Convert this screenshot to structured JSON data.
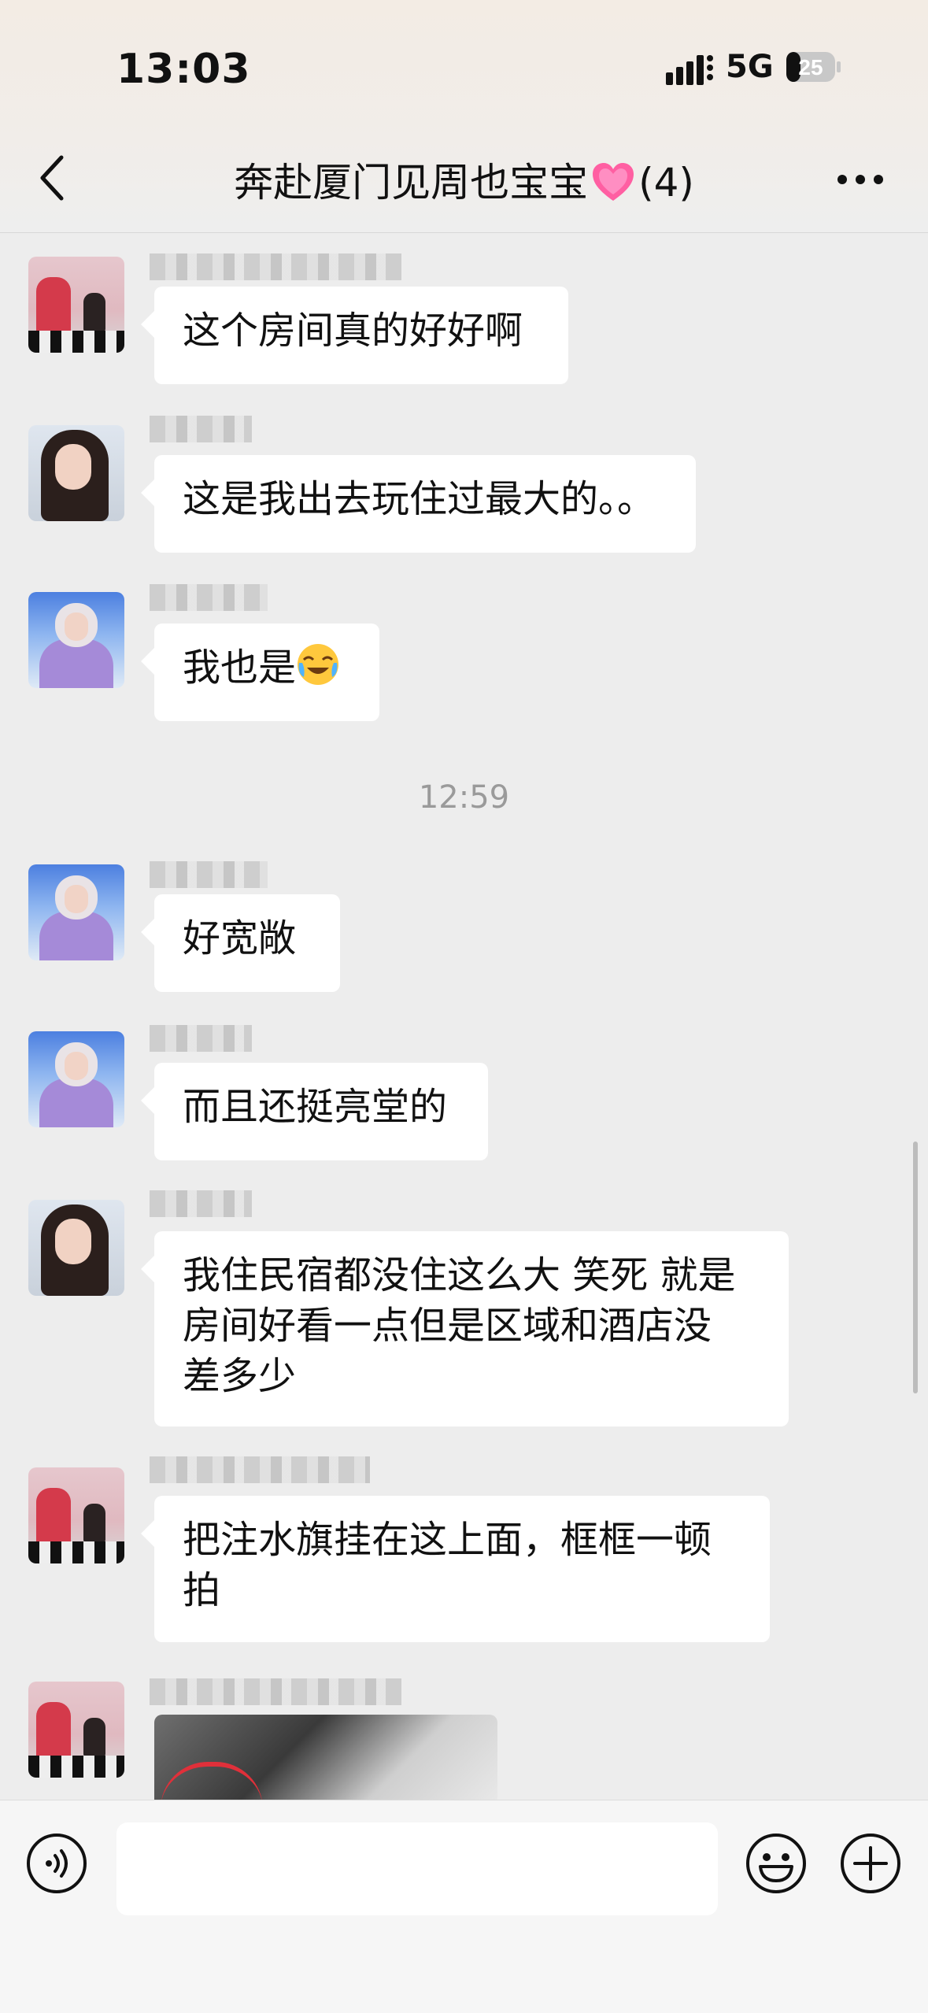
{
  "status": {
    "time": "13:03",
    "network": "5G",
    "battery": "25"
  },
  "header": {
    "title": "奔赴厦门见周也宝宝",
    "count": "(4)"
  },
  "messages": [
    {
      "text": "这个房间真的好好啊"
    },
    {
      "text": "这是我出去玩住过最大的。。"
    },
    {
      "text": "我也是"
    },
    {
      "text": "好宽敞"
    },
    {
      "text": "而且还挺亮堂的"
    },
    {
      "lines": [
        "我住民宿都没住这么大 笑死 就是",
        "房间好看一点但是区域和酒店没",
        "差多少"
      ]
    },
    {
      "lines": [
        "把注水旗挂在这上面，框框一顿",
        "拍"
      ]
    }
  ],
  "timestamp": "12:59",
  "input": {
    "placeholder": ""
  },
  "icons": {
    "back": "chevron-left-icon",
    "more": "more-dots-icon",
    "voice": "voice-icon",
    "emoji": "emoji-smile-icon",
    "plus": "plus-circle-icon",
    "heart": "pink-heart-emoji",
    "cry_laugh": "crying-laughing-emoji"
  },
  "colors": {
    "bubble": "#ffffff",
    "background": "#ededed",
    "heart": "#ff5fa2"
  }
}
